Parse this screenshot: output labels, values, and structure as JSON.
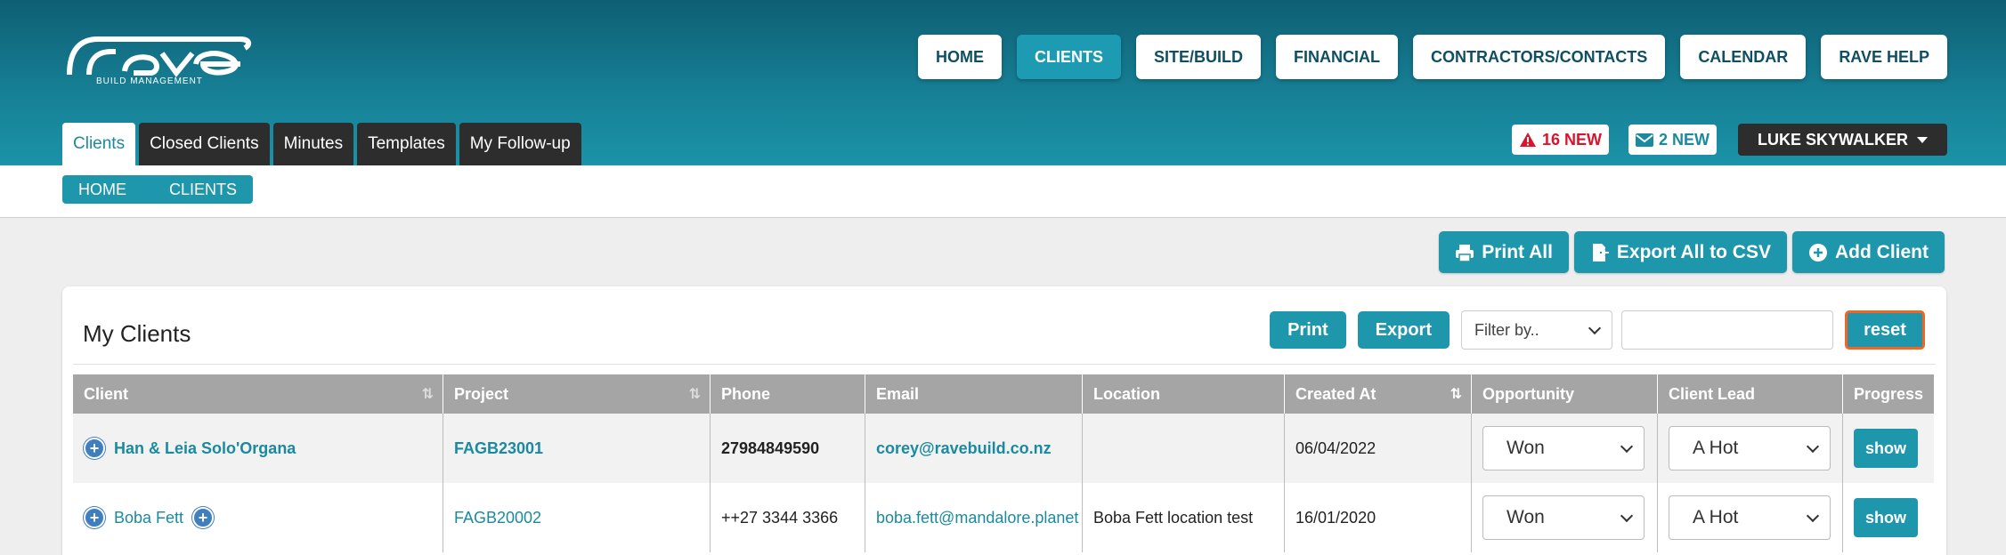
{
  "brand": {
    "logo_text": "rave",
    "tagline": "BUILD MANAGEMENT"
  },
  "topnav": [
    {
      "label": "HOME",
      "active": false
    },
    {
      "label": "CLIENTS",
      "active": true
    },
    {
      "label": "SITE/BUILD",
      "active": false
    },
    {
      "label": "FINANCIAL",
      "active": false
    },
    {
      "label": "CONTRACTORS/CONTACTS",
      "active": false
    },
    {
      "label": "CALENDAR",
      "active": false
    },
    {
      "label": "RAVE HELP",
      "active": false
    }
  ],
  "subtabs": [
    {
      "label": "Clients",
      "active": true
    },
    {
      "label": "Closed Clients",
      "active": false
    },
    {
      "label": "Minutes",
      "active": false
    },
    {
      "label": "Templates",
      "active": false
    },
    {
      "label": "My Follow-up",
      "active": false
    }
  ],
  "alerts": {
    "warnings": "16 NEW",
    "messages": "2 NEW"
  },
  "user": {
    "name": "LUKE SKYWALKER"
  },
  "breadcrumb": [
    "HOME",
    "CLIENTS"
  ],
  "actions": {
    "print_all": "Print All",
    "export_csv": "Export All to CSV",
    "add_client": "Add Client"
  },
  "panel": {
    "title": "My Clients",
    "print": "Print",
    "export": "Export",
    "filter_placeholder": "Filter by..",
    "search_value": "",
    "reset": "reset"
  },
  "table": {
    "columns": [
      "Client",
      "Project",
      "Phone",
      "Email",
      "Location",
      "Created At",
      "Opportunity",
      "Client Lead",
      "Progress"
    ],
    "rows": [
      {
        "client": "Han & Leia Solo'Organa",
        "project": "FAGB23001",
        "phone": "27984849590",
        "email": "corey@ravebuild.co.nz",
        "location": "",
        "created": "06/04/2022",
        "opportunity": "Won",
        "lead": "A Hot",
        "progress": "show"
      },
      {
        "client": "Boba Fett",
        "project": "FAGB20002",
        "phone": "++27 3344 3366",
        "email": "boba.fett@mandalore.planet",
        "location": "Boba Fett location test",
        "created": "16/01/2020",
        "opportunity": "Won",
        "lead": "A Hot",
        "progress": "show"
      }
    ]
  },
  "colors": {
    "header_dark": "#0f5f73",
    "accent": "#1e96ab",
    "alert_red": "#d9142b",
    "reset_border": "#f26522"
  }
}
